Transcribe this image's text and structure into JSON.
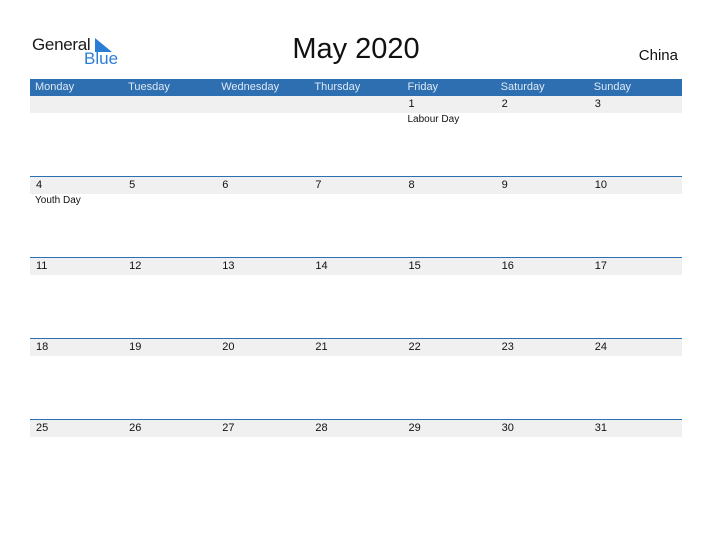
{
  "logo": {
    "text_general": "General",
    "text_blue": "Blue"
  },
  "title": "May 2020",
  "country": "China",
  "colors": {
    "header_bg": "#2e6fb1",
    "row_bg": "#f0f0f0",
    "logo_blue": "#2a7fd4"
  },
  "weekdays": [
    "Monday",
    "Tuesday",
    "Wednesday",
    "Thursday",
    "Friday",
    "Saturday",
    "Sunday"
  ],
  "weeks": [
    {
      "days": [
        "",
        "",
        "",
        "",
        "1",
        "2",
        "3"
      ],
      "events": [
        "",
        "",
        "",
        "",
        "Labour Day",
        "",
        ""
      ]
    },
    {
      "days": [
        "4",
        "5",
        "6",
        "7",
        "8",
        "9",
        "10"
      ],
      "events": [
        "Youth Day",
        "",
        "",
        "",
        "",
        "",
        ""
      ]
    },
    {
      "days": [
        "11",
        "12",
        "13",
        "14",
        "15",
        "16",
        "17"
      ],
      "events": [
        "",
        "",
        "",
        "",
        "",
        "",
        ""
      ]
    },
    {
      "days": [
        "18",
        "19",
        "20",
        "21",
        "22",
        "23",
        "24"
      ],
      "events": [
        "",
        "",
        "",
        "",
        "",
        "",
        ""
      ]
    },
    {
      "days": [
        "25",
        "26",
        "27",
        "28",
        "29",
        "30",
        "31"
      ],
      "events": [
        "",
        "",
        "",
        "",
        "",
        "",
        ""
      ]
    }
  ]
}
